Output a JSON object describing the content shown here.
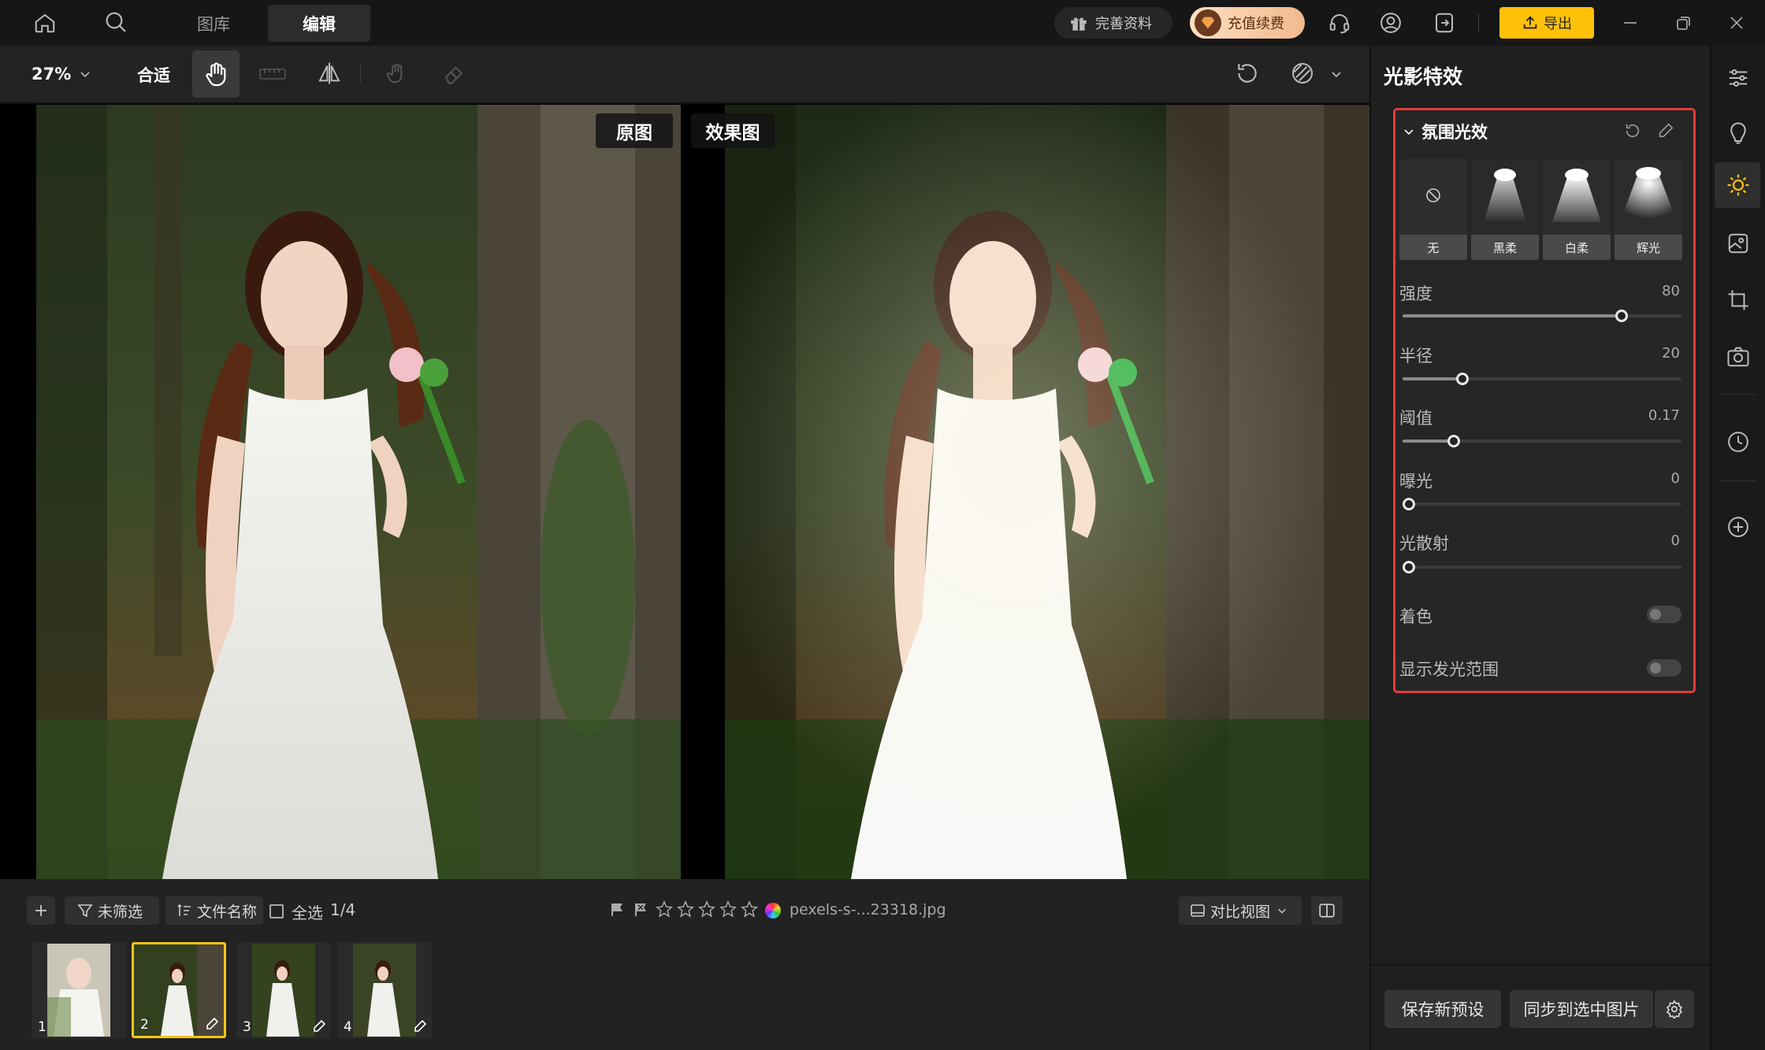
{
  "nav": {
    "library_tab": "图库",
    "edit_tab": "编辑",
    "complete_profile": "完善资料",
    "recharge": "充值续费",
    "export": "导出"
  },
  "toolbar": {
    "zoom": "27%",
    "fit": "合适"
  },
  "canvas": {
    "label_original": "原图",
    "label_result": "效果图"
  },
  "bottom": {
    "filter": "未筛选",
    "sort": "文件名称",
    "select_all": "全选",
    "count": "1/4",
    "filename": "pexels-s-...23318.jpg",
    "compare_view": "对比视图",
    "rating": 0
  },
  "thumbnails": [
    {
      "num": "1",
      "selected": false
    },
    {
      "num": "2",
      "selected": true
    },
    {
      "num": "3",
      "selected": false
    },
    {
      "num": "4",
      "selected": false
    }
  ],
  "panel": {
    "title": "光影特效",
    "section": "氛围光效",
    "presets": [
      {
        "label": "无",
        "icon": "none-icon"
      },
      {
        "label": "黑柔",
        "icon": "spotlight-icon"
      },
      {
        "label": "白柔",
        "icon": "spotlight-icon"
      },
      {
        "label": "辉光",
        "icon": "spotlight-icon"
      }
    ],
    "sliders": [
      {
        "label": "强度",
        "value": "80",
        "fraction": 0.8
      },
      {
        "label": "半径",
        "value": "20",
        "fraction": 0.2
      },
      {
        "label": "阈值",
        "value": "0.17",
        "fraction": 0.17
      },
      {
        "label": "曝光",
        "value": "0",
        "fraction": 0
      },
      {
        "label": "光散射",
        "value": "0",
        "fraction": 0
      }
    ],
    "toggles": [
      {
        "label": "着色",
        "on": false
      },
      {
        "label": "显示发光范围",
        "on": false
      }
    ],
    "save_preset": "保存新预设",
    "sync": "同步到选中图片"
  },
  "colors": {
    "accent": "#ffc107",
    "highlight_border": "#e23b3b",
    "selected_thumb": "#f5c518"
  }
}
